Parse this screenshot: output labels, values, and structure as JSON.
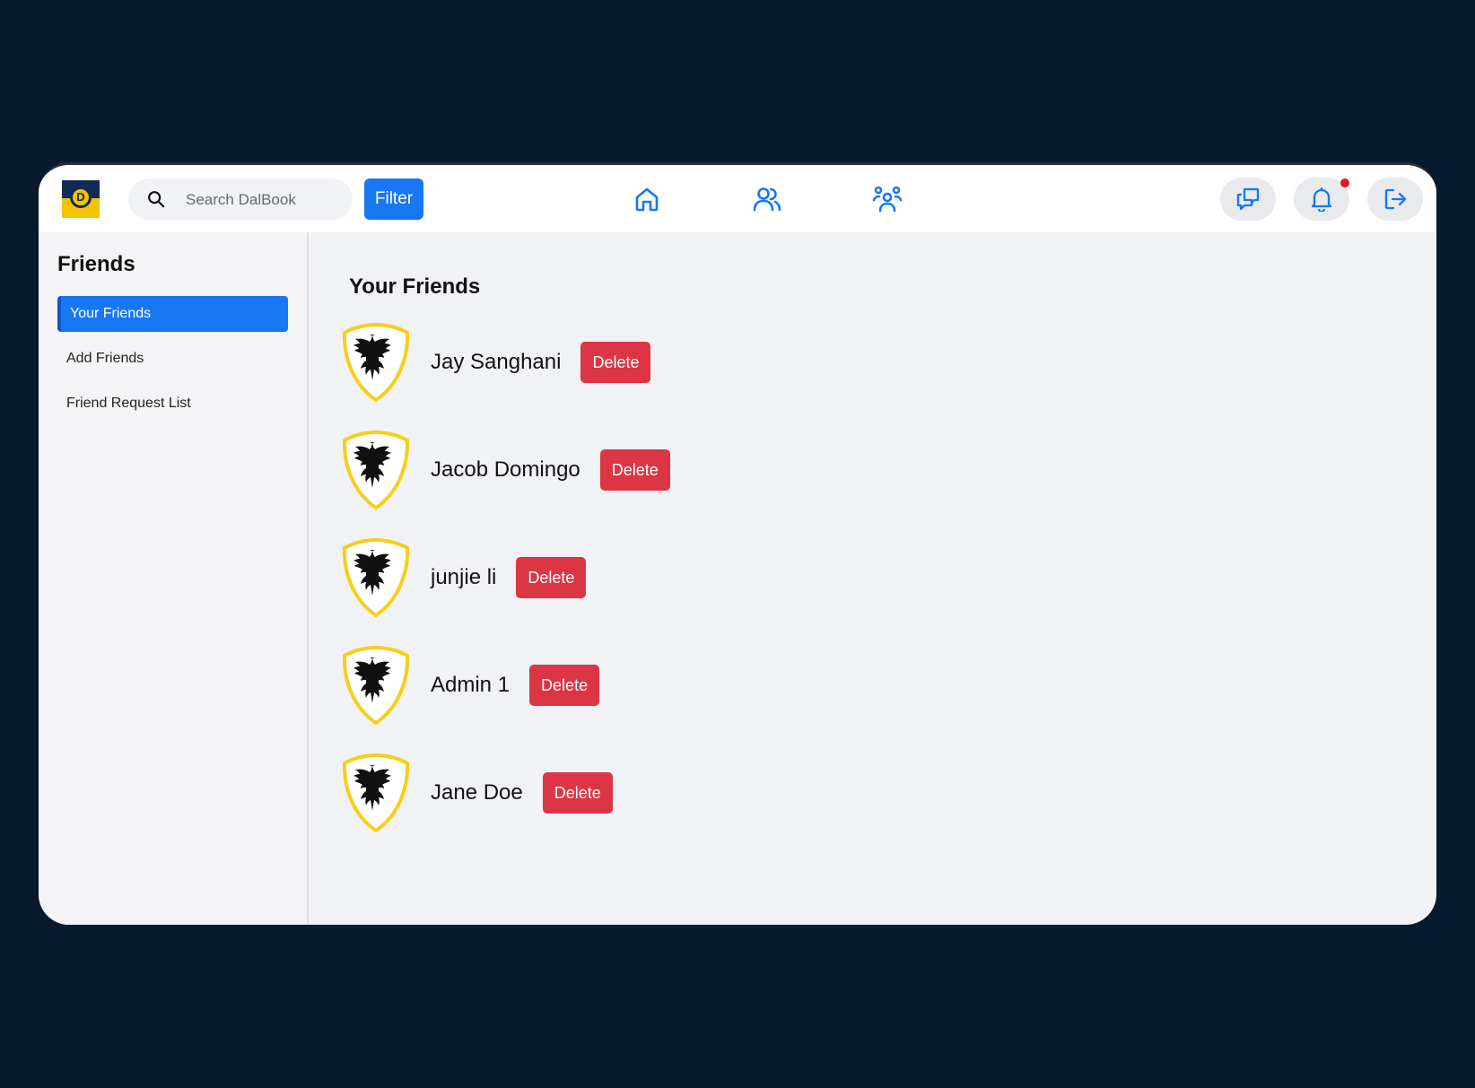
{
  "app": {
    "name": "DalBook",
    "logo_letter": "D"
  },
  "search": {
    "placeholder": "Search DalBook",
    "value": ""
  },
  "toolbar": {
    "filter_label": "Filter"
  },
  "nav": {
    "icons": [
      "home-icon",
      "friends-icon",
      "groups-icon"
    ],
    "accent": "#1877f2"
  },
  "actions": {
    "icons": [
      "messages-icon",
      "notifications-icon",
      "logout-icon"
    ],
    "notification_dot_color": "#e8141c"
  },
  "sidebar": {
    "title": "Friends",
    "items": [
      {
        "label": "Your Friends",
        "active": true
      },
      {
        "label": "Add Friends",
        "active": false
      },
      {
        "label": "Friend Request List",
        "active": false
      }
    ]
  },
  "main": {
    "title": "Your Friends",
    "delete_label": "Delete",
    "friends": [
      {
        "name": "Jay Sanghani"
      },
      {
        "name": "Jacob Domingo"
      },
      {
        "name": "junjie li"
      },
      {
        "name": "Admin 1"
      },
      {
        "name": "Jane Doe"
      }
    ]
  },
  "colors": {
    "primary": "#1877f2",
    "danger": "#dc3545",
    "page_background": "#081a30"
  }
}
